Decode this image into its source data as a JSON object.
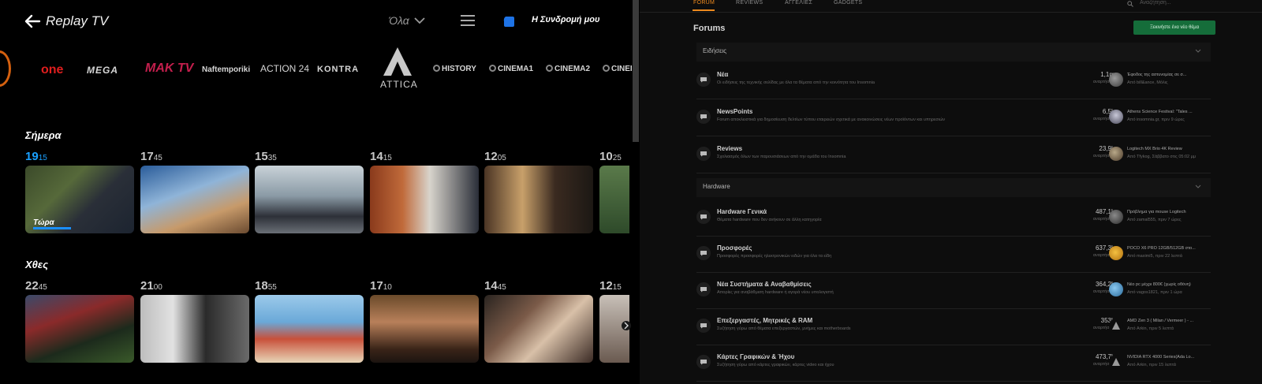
{
  "replay": {
    "title": "Replay TV",
    "filter": "Όλα",
    "subscription": "Η Συνδρομή μου",
    "channels": {
      "one": "one",
      "mega": "MEGA",
      "mak": "MAK TV",
      "naft": "Naftemporiki",
      "action": "ACTION 24",
      "kontra": "KONTRA",
      "attica": "ATTICA",
      "history": "HISTORY",
      "cinema1": "CINEMA1",
      "cinema2": "CINEMA2",
      "cinema3": "CINEI"
    },
    "today": {
      "label": "Σήμερα",
      "now": "Τώρα",
      "now_progress": 0.35,
      "items": [
        {
          "h": "19",
          "m": "15"
        },
        {
          "h": "17",
          "m": "45"
        },
        {
          "h": "15",
          "m": "35"
        },
        {
          "h": "14",
          "m": "15"
        },
        {
          "h": "12",
          "m": "05"
        },
        {
          "h": "10",
          "m": "25"
        }
      ]
    },
    "yesterday": {
      "label": "Χθες",
      "items": [
        {
          "h": "22",
          "m": "45"
        },
        {
          "h": "21",
          "m": "00"
        },
        {
          "h": "18",
          "m": "55"
        },
        {
          "h": "17",
          "m": "10"
        },
        {
          "h": "14",
          "m": "45"
        },
        {
          "h": "12",
          "m": "15"
        }
      ]
    }
  },
  "forum": {
    "tabs": [
      "FORUM",
      "REVIEWS",
      "ΑΓΓΕΛΙΕΣ",
      "GADGETS"
    ],
    "search_placeholder": "Αναζήτηση...",
    "title": "Forums",
    "new_topic": "Ξεκινήστε ένα νέο θέμα",
    "sections": [
      {
        "label": "Ειδήσεις"
      },
      {
        "label": "Hardware"
      }
    ],
    "rows": [
      {
        "title": "Νέα",
        "desc": "Οι ειδήσεις της τεχνικής σελίδας με όλα τα θέματα από την κοινότητα του Insomnia",
        "count": "1,1m",
        "count_label": "αναρτήσεις",
        "last": "Έφοδος της αστυνομίας σε σ...",
        "by": "Από bill&ance, Μόλις"
      },
      {
        "title": "NewsPoints",
        "desc": "Forum αποκλειστικά για δημοσίευση δελτίων τύπου εταιρειών σχετικά με ανακοινώσεις νέων προϊόντων και υπηρεσιών",
        "count": "6,5k",
        "count_label": "αναρτήσεις",
        "last": "Athens Science Festival: \"Tales ...",
        "by": "Από insomnia.gr, πριν 9 ώρες"
      },
      {
        "title": "Reviews",
        "desc": "Σχολιασμός όλων των παρουσιάσεων από την ομάδα του Insomnia",
        "count": "23,9k",
        "count_label": "αναρτήσεις",
        "last": "Logitech MX Brio 4K Review",
        "by": "Από Tfykog, Σάββατο στις 05:02 μμ"
      },
      {
        "title": "Hardware Γενικά",
        "desc": "Θέματα hardware που δεν ανήκουν σε άλλη κατηγορία",
        "count": "487,1k",
        "count_label": "αναρτήσεις",
        "last": "Πρόβλημα για mouse Logitech",
        "by": "Από zamal555, πριν 7 ώρες"
      },
      {
        "title": "Προσφορές",
        "desc": "Προσφορές προσφορές ηλεκτρονικών ειδών για όλα τα είδη",
        "count": "637,3k",
        "count_label": "αναρτήσεις",
        "last": "POCO X6 PRO 12GB/512GB στο...",
        "by": "Από maximi5, πριν 22 λεπτά"
      },
      {
        "title": "Νέα Συστήματα & Αναβαθμίσεις",
        "desc": "Απορίες για αναβάθμιση hardware ή αγορά νέου υπολογιστή",
        "count": "364,2k",
        "count_label": "αναρτήσεις",
        "last": "Νέο pc μέχρι 800€ (χωρίς οθόνη)",
        "by": "Από vagos1821, πριν 1 ώρα"
      },
      {
        "title": "Επεξεργαστές, Μητρικές & RAM",
        "desc": "Συζήτηση γύρω από θέματα επεξεργαστών, μνήμες και motherboards",
        "count": "353k",
        "count_label": "αναρτήσεις",
        "last": "AMD Zen 3 ( Milan / Vermeer ) - ...",
        "by": "Από Arkin, πριν 5 λεπτά"
      },
      {
        "title": "Κάρτες Γραφικών & Ήχου",
        "desc": "Συζήτηση γύρω από κάρτες γραφικών, κάρτες video και ήχου",
        "count": "473,7k",
        "count_label": "αναρτήσεις",
        "last": "NVIDIA RTX 4000 Series(Ada Lo...",
        "by": "Από Arkin, πριν 15 λεπτά"
      }
    ]
  },
  "colors": {
    "accent_orange": "#ee8a1e",
    "live_blue": "#1aa0ff",
    "button_green": "#156d3a"
  }
}
